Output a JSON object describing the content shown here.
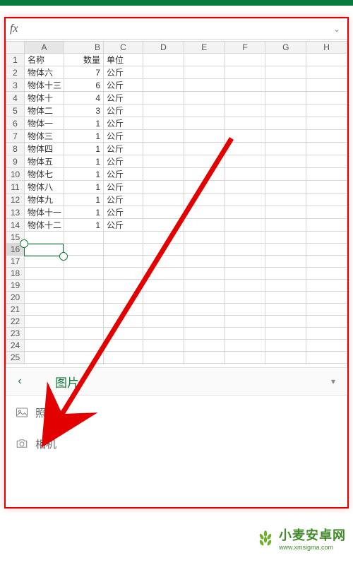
{
  "formula_bar": {
    "fx": "fx",
    "value": "",
    "expand_glyph": "⌄"
  },
  "columns": [
    "A",
    "B",
    "C",
    "D",
    "E",
    "F",
    "G",
    "H"
  ],
  "row_count": 26,
  "selected_cell": {
    "row": 16,
    "col": "A"
  },
  "header_row": {
    "A": "名称",
    "B": "数量",
    "C": "单位"
  },
  "rows": [
    {
      "A": "物体六",
      "B": 7,
      "C": "公斤"
    },
    {
      "A": "物体十三",
      "B": 6,
      "C": "公斤"
    },
    {
      "A": "物体十",
      "B": 4,
      "C": "公斤"
    },
    {
      "A": "物体二",
      "B": 3,
      "C": "公斤"
    },
    {
      "A": "物体一",
      "B": 1,
      "C": "公斤"
    },
    {
      "A": "物体三",
      "B": 1,
      "C": "公斤"
    },
    {
      "A": "物体四",
      "B": 1,
      "C": "公斤"
    },
    {
      "A": "物体五",
      "B": 1,
      "C": "公斤"
    },
    {
      "A": "物体七",
      "B": 1,
      "C": "公斤"
    },
    {
      "A": "物体八",
      "B": 1,
      "C": "公斤"
    },
    {
      "A": "物体九",
      "B": 1,
      "C": "公斤"
    },
    {
      "A": "物体十一",
      "B": 1,
      "C": "公斤"
    },
    {
      "A": "物体十二",
      "B": 1,
      "C": "公斤"
    }
  ],
  "bottom_sheet": {
    "back_glyph": "‹",
    "title": "图片",
    "expand_glyph": "▾",
    "options": [
      {
        "icon": "photo-icon",
        "label": "照片"
      },
      {
        "icon": "camera-icon",
        "label": "相机"
      }
    ]
  },
  "watermark": {
    "text": "小麦安卓网",
    "sub": "www.xmsigma.com"
  },
  "colors": {
    "accent": "#0f7a3a",
    "annotation": "#e20000"
  }
}
